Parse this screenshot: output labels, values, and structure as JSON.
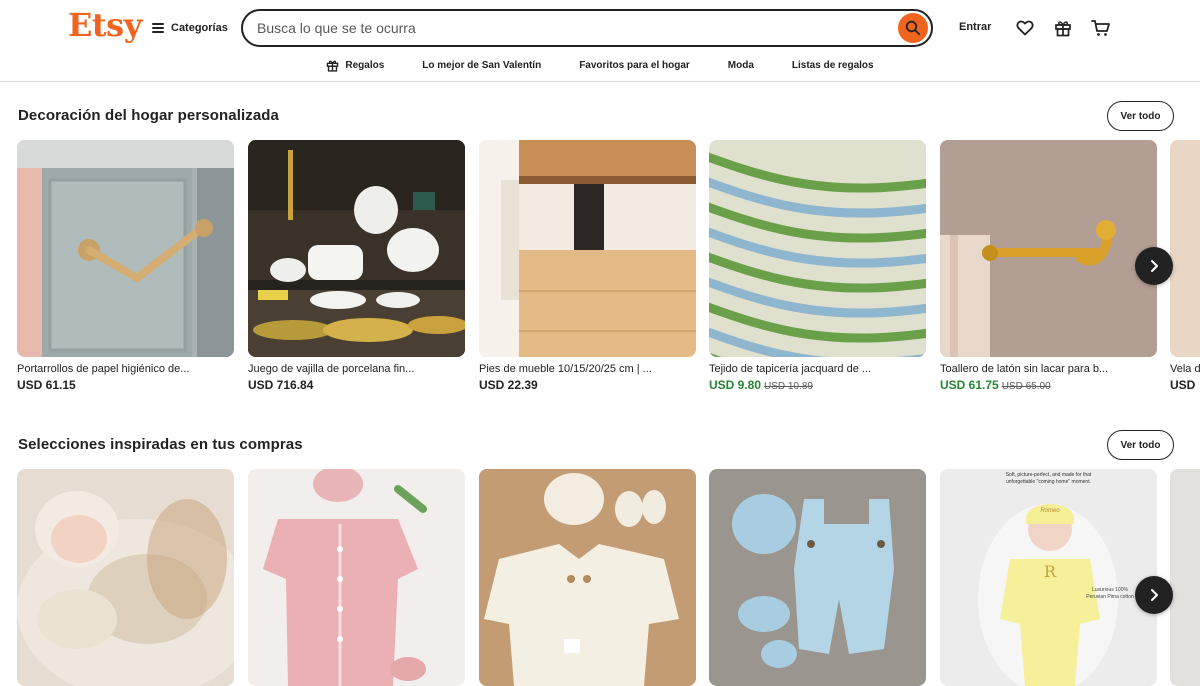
{
  "header": {
    "logo": "Etsy",
    "categories_label": "Categorías",
    "search_placeholder": "Busca lo que se te ocurra",
    "signin_label": "Entrar",
    "icons": [
      "heart-icon",
      "gift-icon",
      "cart-icon"
    ]
  },
  "subnav": [
    {
      "label": "Regalos",
      "icon": "gift-icon"
    },
    {
      "label": "Lo mejor de San Valentín"
    },
    {
      "label": "Favoritos para el hogar"
    },
    {
      "label": "Moda"
    },
    {
      "label": "Listas de regalos"
    }
  ],
  "sections": [
    {
      "title": "Decoración del hogar personalizada",
      "see_all": "Ver todo",
      "items": [
        {
          "title": "Portarrollos de papel higiénico de...",
          "price": "USD 61.15"
        },
        {
          "title": "Juego de vajilla de porcelana fin...",
          "price": "USD 716.84"
        },
        {
          "title": "Pies de mueble 10/15/20/25 cm | ...",
          "price": "USD 22.39"
        },
        {
          "title": "Tejido de tapicería jacquard de ...",
          "price": "USD 9.80",
          "original_price": "USD 10.89",
          "sale": true
        },
        {
          "title": "Toallero de latón sin lacar para b...",
          "price": "USD 61.75",
          "original_price": "USD 65.00",
          "sale": true
        },
        {
          "title": "Vela d",
          "price": "USD"
        }
      ]
    },
    {
      "title": "Selecciones inspiradas en tus compras",
      "see_all": "Ver todo",
      "items": [
        {
          "title": ""
        },
        {
          "title": ""
        },
        {
          "title": ""
        },
        {
          "title": ""
        },
        {
          "title": "",
          "image_text": [
            "Soft, picture-perfect, and made for that",
            "unforgettable \"coming home\" moment.",
            "Romeo",
            "Luxurious 100%",
            "Peruvian Pima cotton"
          ]
        },
        {
          "title": ""
        }
      ]
    }
  ],
  "colors": {
    "brand": "#f1641e",
    "sale": "#258635",
    "text": "#222222"
  }
}
